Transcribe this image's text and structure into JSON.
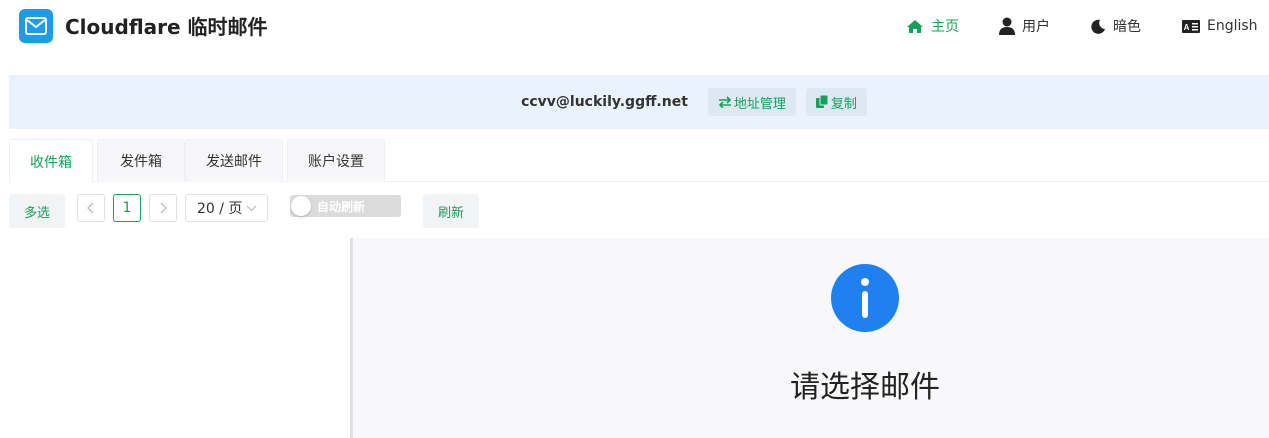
{
  "header": {
    "title": "Cloudflare 临时邮件",
    "nav": {
      "home": "主页",
      "user": "用户",
      "dark": "暗色",
      "lang": "English"
    }
  },
  "address": {
    "email": "ccvv@luckily.ggff.net",
    "manage_label": "地址管理",
    "copy_label": "复制"
  },
  "tabs": [
    {
      "label": "收件箱"
    },
    {
      "label": "发件箱"
    },
    {
      "label": "发送邮件"
    },
    {
      "label": "账户设置"
    }
  ],
  "toolbar": {
    "multi_select": "多选",
    "current_page": "1",
    "page_size": "20 / 页",
    "auto_refresh": "自动刷新",
    "refresh": "刷新"
  },
  "detail": {
    "empty_text": "请选择邮件"
  },
  "colors": {
    "accent": "#18a058",
    "logo_bg": "#1e9ce8",
    "info": "#2080f0"
  }
}
